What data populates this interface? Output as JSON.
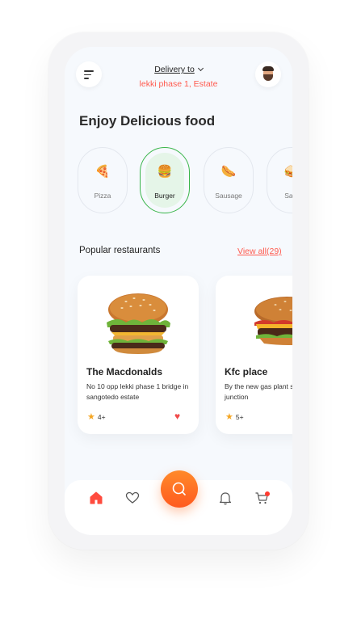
{
  "header": {
    "delivery_label": "Delivery to",
    "delivery_address": "lekki phase 1, Estate"
  },
  "page_title": "Enjoy Delicious food",
  "categories": [
    {
      "label": "Pizza",
      "icon": "🍕",
      "active": false
    },
    {
      "label": "Burger",
      "icon": "🍔",
      "active": true
    },
    {
      "label": "Sausage",
      "icon": "🌭",
      "active": false
    },
    {
      "label": "Sam",
      "icon": "🥪",
      "active": false
    }
  ],
  "popular": {
    "title": "Popular restaurants",
    "view_all": "View all(29)"
  },
  "restaurants": [
    {
      "name": "The Macdonalds",
      "address": "No 10 opp lekki phase 1 bridge in sangotedo estate",
      "rating": "4+",
      "favorite": true
    },
    {
      "name": "Kfc place",
      "address": "By the new gas plant sangotedo junction",
      "rating": "5+",
      "favorite": false
    }
  ],
  "colors": {
    "accent": "#ff5a4e",
    "fab": "#ff6a1f",
    "active_category_border": "#39b54a",
    "active_category_bg": "#e5f5e8",
    "star": "#f5a623",
    "heart": "#f04b4b"
  },
  "nav": {
    "items": [
      "home-icon",
      "heart-icon",
      "search-icon",
      "bell-icon",
      "cart-icon"
    ]
  }
}
